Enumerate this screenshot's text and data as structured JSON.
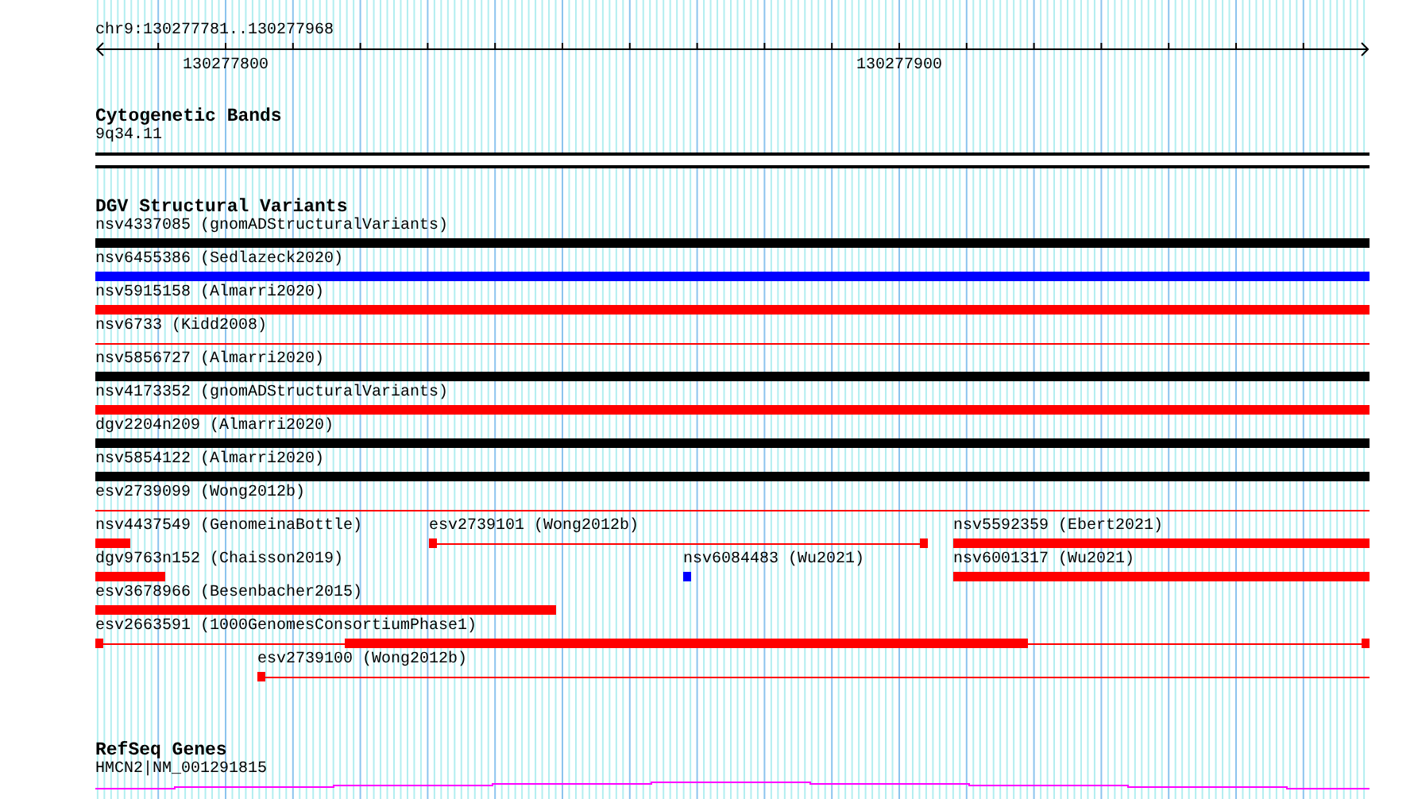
{
  "ruler": {
    "location": "chr9:130277781..130277968",
    "tick_labels": [
      "130277800",
      "130277900"
    ]
  },
  "cytogenetic_bands": {
    "title": "Cytogenetic Bands",
    "band": "9q34.11"
  },
  "dgv_structural_variants": {
    "title": "DGV Structural Variants",
    "rows": [
      [
        {
          "label": "nsv4337085 (gnomADStructuralVariants)",
          "kind": "bar",
          "color": "#000000"
        }
      ],
      [
        {
          "label": "nsv6455386 (Sedlazeck2020)",
          "kind": "bar",
          "color": "#0000ff"
        }
      ],
      [
        {
          "label": "nsv5915158 (Almarri2020)",
          "kind": "bar",
          "color": "#ff0000"
        }
      ],
      [
        {
          "label": "nsv6733 (Kidd2008)",
          "kind": "line",
          "color": "#ff0000"
        }
      ],
      [
        {
          "label": "nsv5856727 (Almarri2020)",
          "kind": "bar",
          "color": "#000000"
        }
      ],
      [
        {
          "label": "nsv4173352 (gnomADStructuralVariants)",
          "kind": "bar",
          "color": "#ff0000"
        }
      ],
      [
        {
          "label": "dgv2204n209 (Almarri2020)",
          "kind": "bar",
          "color": "#000000"
        }
      ],
      [
        {
          "label": "nsv5854122 (Almarri2020)",
          "kind": "bar",
          "color": "#000000"
        }
      ],
      [
        {
          "label": "esv2739099 (Wong2012b)",
          "kind": "line",
          "color": "#ff0000"
        }
      ],
      [
        {
          "label": "nsv4437549 (GenomeinaBottle)",
          "kind": "bar",
          "color": "#ff0000"
        },
        {
          "label": "esv2739101 (Wong2012b)",
          "kind": "linked",
          "color": "#ff0000"
        },
        {
          "label": "nsv5592359 (Ebert2021)",
          "kind": "bar",
          "color": "#ff0000"
        }
      ],
      [
        {
          "label": "dgv9763n152 (Chaisson2019)",
          "kind": "bar",
          "color": "#ff0000"
        },
        {
          "label": "nsv6084483 (Wu2021)",
          "kind": "bar",
          "color": "#0000ff"
        },
        {
          "label": "nsv6001317 (Wu2021)",
          "kind": "bar",
          "color": "#ff0000"
        }
      ],
      [
        {
          "label": "esv3678966 (Besenbacher2015)",
          "kind": "bar",
          "color": "#ff0000"
        }
      ],
      [
        {
          "label": "esv2663591 (1000GenomesConsortiumPhase1)",
          "kind": "gapped",
          "color": "#ff0000"
        }
      ],
      [
        {
          "label": "esv2739100 (Wong2012b)",
          "kind": "linked",
          "color": "#ff0000"
        }
      ]
    ]
  },
  "refseq_genes": {
    "title": "RefSeq Genes",
    "gene": "HMCN2|NM_001291815"
  }
}
